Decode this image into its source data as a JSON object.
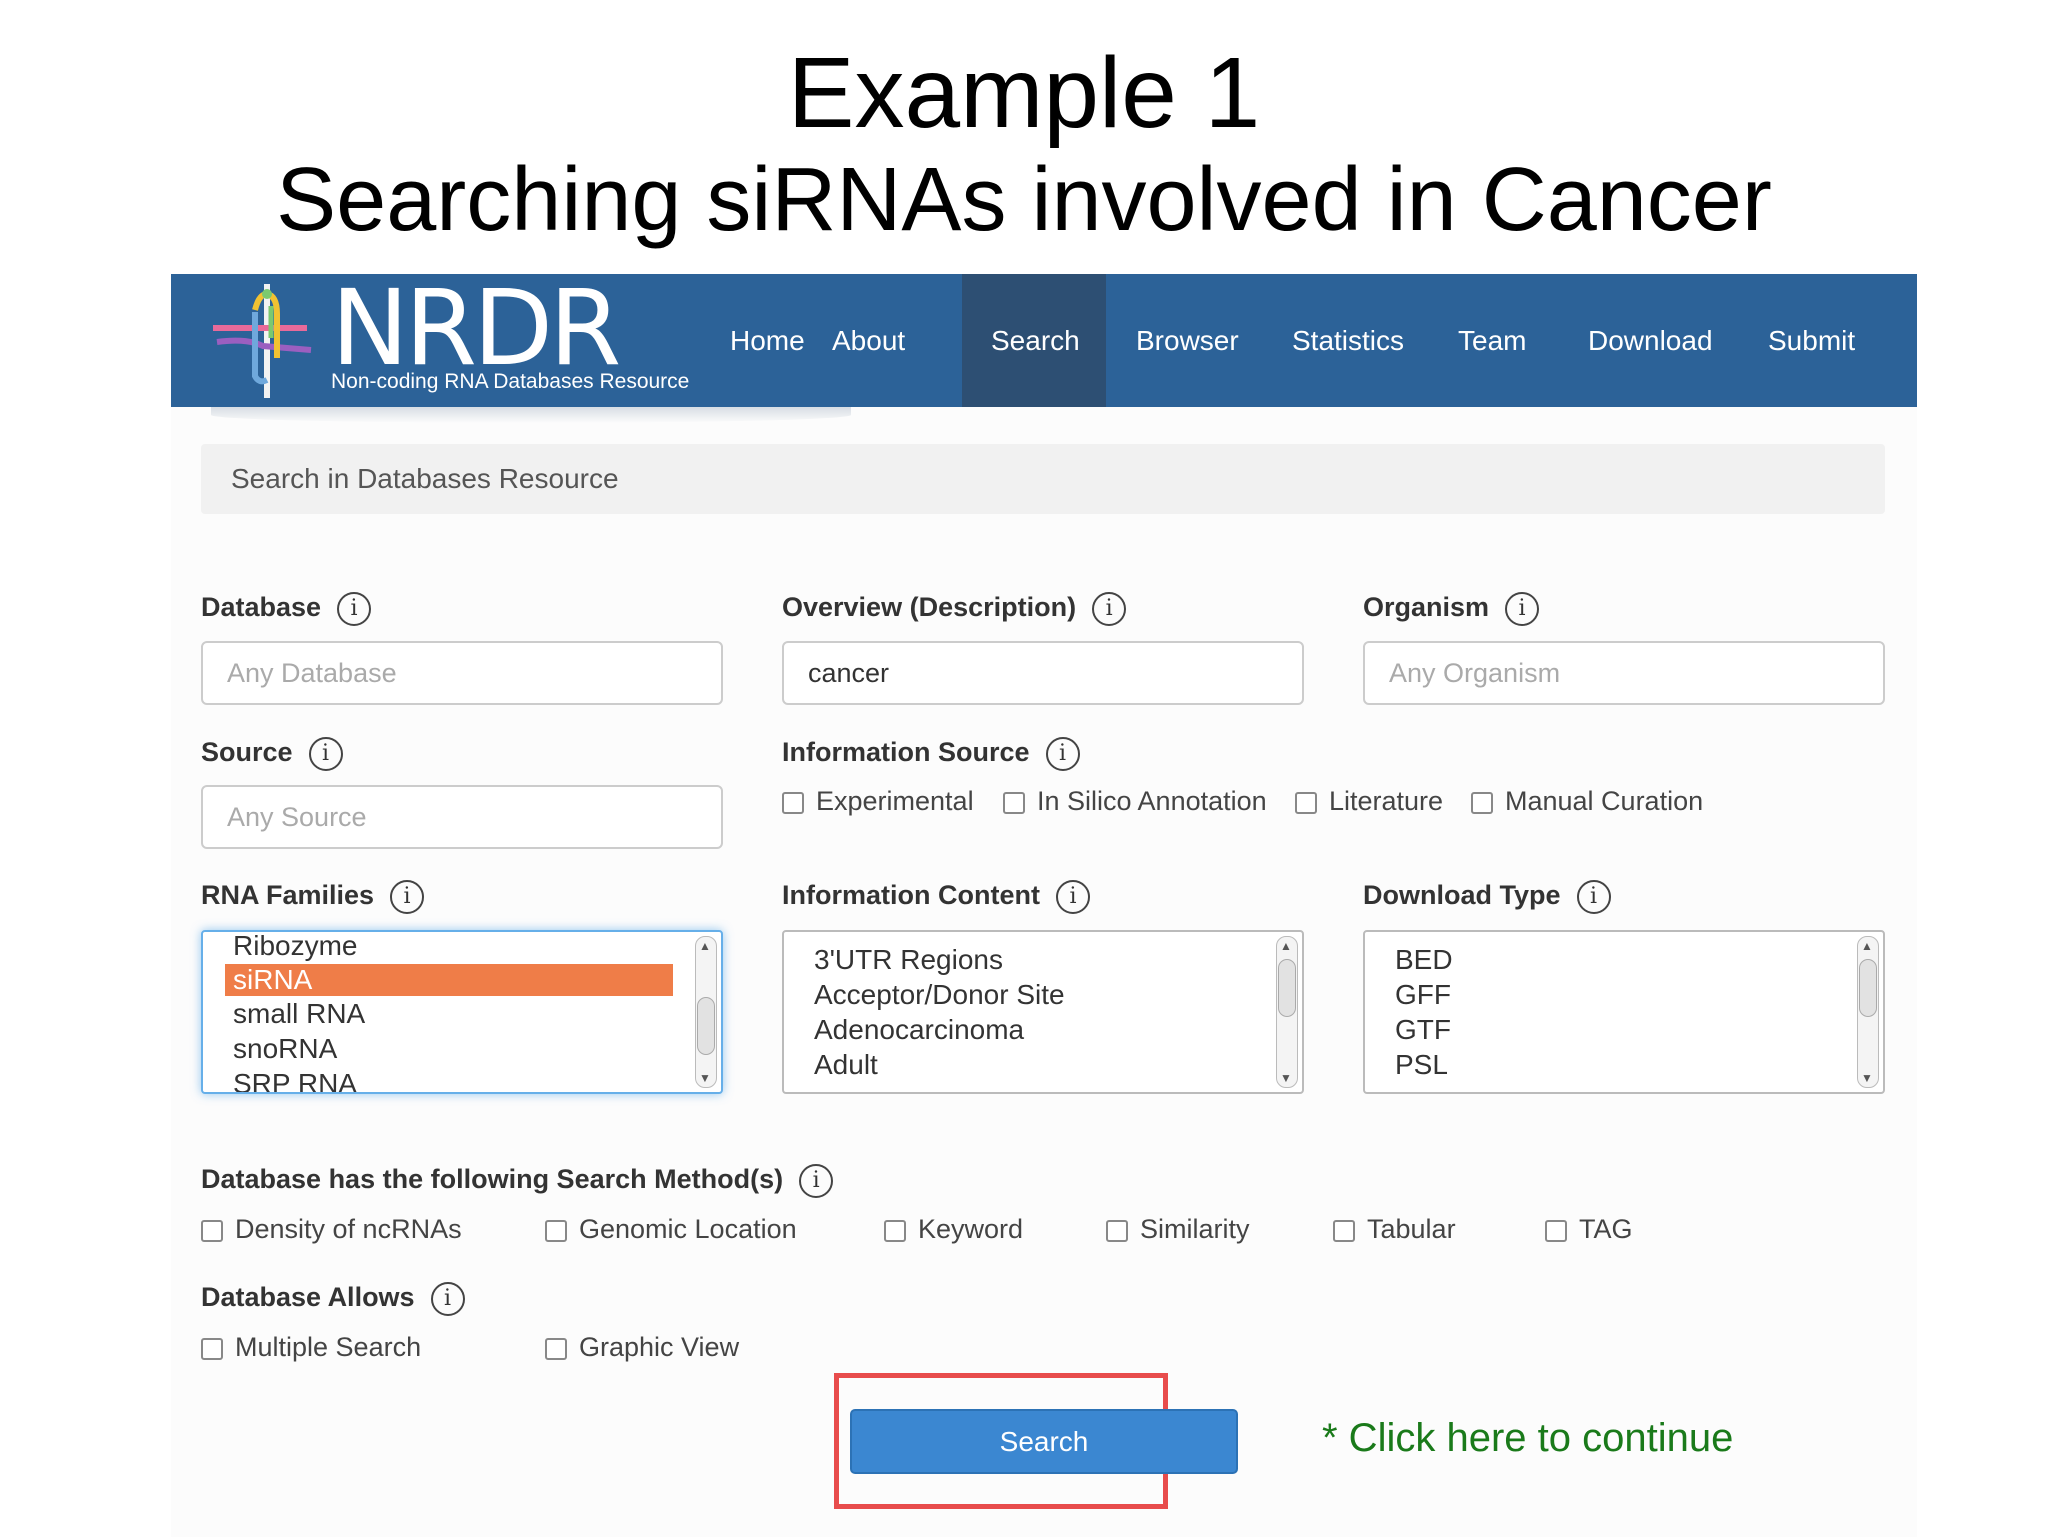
{
  "slide": {
    "title": "Example 1",
    "subtitle": "Searching siRNAs involved in Cancer",
    "annotation": "* Click here to continue"
  },
  "header": {
    "logo": "NRDR",
    "tagline": "Non-coding RNA Databases Resource",
    "nav": [
      "Home",
      "About",
      "Search",
      "Browser",
      "Statistics",
      "Team",
      "Download",
      "Submit"
    ],
    "active": "Search"
  },
  "breadcrumb": "Search in Databases Resource",
  "fields": {
    "database": {
      "label": "Database",
      "placeholder": "Any Database"
    },
    "overview": {
      "label": "Overview (Description)",
      "value": "cancer"
    },
    "organism": {
      "label": "Organism",
      "placeholder": "Any Organism"
    },
    "source": {
      "label": "Source",
      "placeholder": "Any Source"
    },
    "info_source": {
      "label": "Information Source",
      "options": [
        "Experimental",
        "In Silico Annotation",
        "Literature",
        "Manual Curation"
      ]
    },
    "rna_families": {
      "label": "RNA Families",
      "options": [
        "Ribozyme",
        "siRNA",
        "small RNA",
        "snoRNA",
        "SRP RNA"
      ],
      "selected": "siRNA"
    },
    "info_content": {
      "label": "Information Content",
      "options": [
        "3'UTR Regions",
        "Acceptor/Donor Site",
        "Adenocarcinoma",
        "Adult"
      ]
    },
    "download_type": {
      "label": "Download Type",
      "options": [
        "BED",
        "GFF",
        "GTF",
        "PSL"
      ]
    },
    "search_methods": {
      "label": "Database has the following Search Method(s)",
      "options": [
        "Density of ncRNAs",
        "Genomic Location",
        "Keyword",
        "Similarity",
        "Tabular",
        "TAG"
      ]
    },
    "allows": {
      "label": "Database Allows",
      "options": [
        "Multiple Search",
        "Graphic View"
      ]
    }
  },
  "search_button": "Search",
  "colors": {
    "navbar": "#2c6298",
    "nav_active": "#2d4f73",
    "selected_option": "#ef7d48",
    "button": "#3b87d1",
    "highlight": "#e84c4c",
    "annotation": "#1a7a1a"
  }
}
